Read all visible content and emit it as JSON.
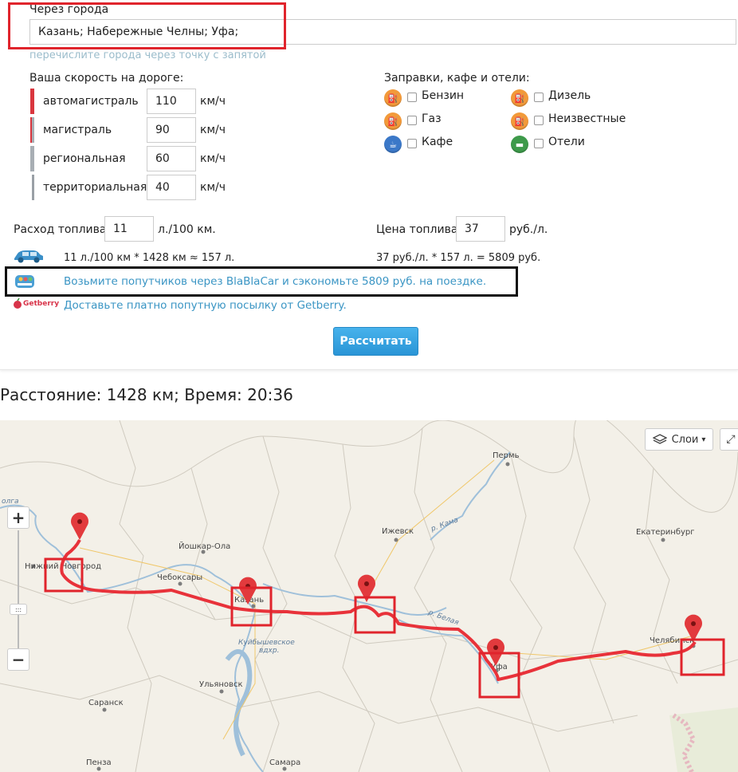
{
  "via": {
    "label": "Через города",
    "value": "Казань; Набережные Челны; Уфа;",
    "hint": "перечислите города через точку с запятой"
  },
  "speed": {
    "title": "Ваша скорость на дороге:",
    "unit": "км/ч",
    "rows": [
      {
        "label": "автомагистраль",
        "value": "110",
        "color": "#d9363e"
      },
      {
        "label": "магистраль",
        "value": "90",
        "color": "#c94d55"
      },
      {
        "label": "региональная",
        "value": "60",
        "color": "#a8aeb4"
      },
      {
        "label": "территориальная",
        "value": "40",
        "color": "#9aa0a6"
      }
    ]
  },
  "poi": {
    "title": "Заправки, кафе и отели:",
    "items": [
      {
        "label": "Бензин",
        "icon": "fuel-pump-icon",
        "color": "#f29a3a"
      },
      {
        "label": "Дизель",
        "icon": "fuel-pump-icon",
        "color": "#f29a3a"
      },
      {
        "label": "Газ",
        "icon": "fuel-pump-icon",
        "color": "#f29a3a"
      },
      {
        "label": "Неизвестные",
        "icon": "fuel-pump-icon",
        "color": "#f29a3a"
      },
      {
        "label": "Кафе",
        "icon": "cup-icon",
        "color": "#3b78c8"
      },
      {
        "label": "Отели",
        "icon": "bed-icon",
        "color": "#3e9a4a"
      }
    ]
  },
  "fuel": {
    "consumption_label": "Расход топлива",
    "consumption_value": "11",
    "consumption_unit": "л./100 км.",
    "price_label": "Цена топлива",
    "price_value": "37",
    "price_unit": "руб./л.",
    "calc_left": "11 л./100 км * 1428 км ≈ 157 л.",
    "calc_right": "37 руб./л. * 157 л. = 5809 руб."
  },
  "links": {
    "blablacar": "Возьмите попутчиков через BlaBlaCar и сэкономьте 5809 руб. на поездке.",
    "getberry": "Доставьте платно попутную посылку от Getberry.",
    "getberry_logo": "Getberry"
  },
  "calculate_button": "Рассчитать",
  "result": "Расстояние: 1428 км; Время: 20:36",
  "map": {
    "layers_label": "Слои",
    "zoom_in": "+",
    "zoom_out": "−",
    "cities": [
      {
        "name": "Пермь"
      },
      {
        "name": "Йошкар-Ола"
      },
      {
        "name": "Нижний Новгород"
      },
      {
        "name": "Чебоксары"
      },
      {
        "name": "Ижевск"
      },
      {
        "name": "Екатеринбург"
      },
      {
        "name": "Казань"
      },
      {
        "name": "Уфа"
      },
      {
        "name": "Челябинск"
      },
      {
        "name": "Саранск"
      },
      {
        "name": "Ульяновск"
      },
      {
        "name": "Пенза"
      },
      {
        "name": "Самара"
      }
    ],
    "rivers": [
      "олга",
      "р. Кама",
      "р. Белая",
      "Куйбышевское",
      "вдхр."
    ]
  },
  "colors": {
    "accent": "#3a95c4",
    "route": "#e8323a",
    "highlight_box": "#e0242c"
  }
}
